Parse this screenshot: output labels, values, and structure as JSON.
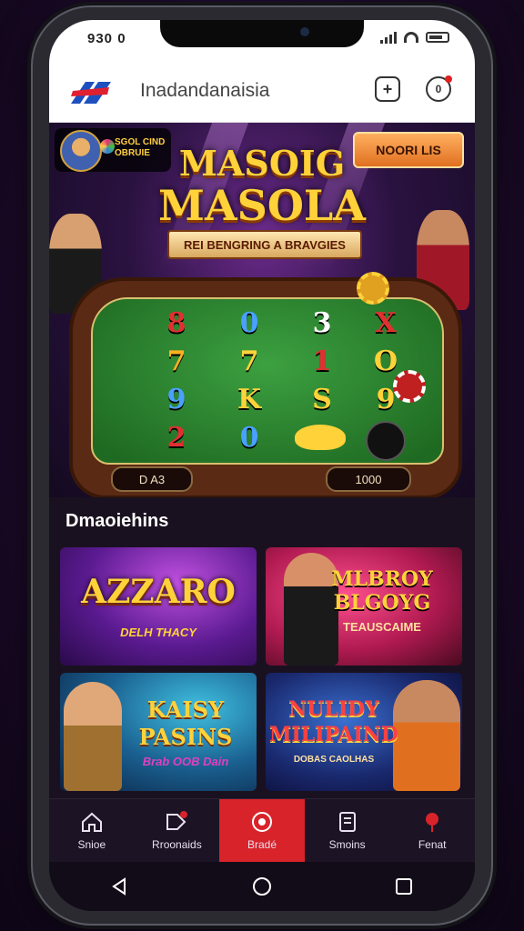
{
  "status": {
    "time": "930 0"
  },
  "appbar": {
    "title": "Inadandanaisia",
    "add_icon": "plus-square-icon",
    "profile_icon": "circle-badge-icon"
  },
  "hero": {
    "badge_logo": "SGOL CIND\nOBRUIE",
    "cta_label": "NOORI LIS",
    "title_line1": "MASOIG",
    "title_line2": "MASOLA",
    "ribbon": "REI BENGRING A BRAVGIES",
    "counter_left": "D A3",
    "counter_right": "1000",
    "symbols": [
      "8",
      "0",
      "3",
      "X",
      "7",
      "7",
      "1",
      "O",
      "9",
      "K",
      "S",
      "9",
      "2",
      "0",
      "",
      ""
    ]
  },
  "section": {
    "title": "Dmaoiehins"
  },
  "cards": [
    {
      "title": "AZZARO",
      "subtitle": "DELH THACY"
    },
    {
      "title": "MLBROY BLGOYG",
      "subtitle": "TEAUSCAIME"
    },
    {
      "title": "KAISY PASINS",
      "subtitle": "Brab OOB Dain"
    },
    {
      "title": "NULIDY MILIPAIND",
      "subtitle": "DOBAS CAOLHAS"
    }
  ],
  "nav": [
    {
      "label": "Snioe",
      "icon": "home-icon",
      "active": false
    },
    {
      "label": "Rroonaids",
      "icon": "tag-badge-icon",
      "active": false
    },
    {
      "label": "Bradé",
      "icon": "target-icon",
      "active": true
    },
    {
      "label": "Smoins",
      "icon": "document-icon",
      "active": false
    },
    {
      "label": "Fenat",
      "icon": "pin-icon",
      "active": false
    }
  ],
  "colors": {
    "accent": "#d8232a",
    "gold": "#ffd23a",
    "felt": "#2f8a34",
    "nav_bg": "#1c1424"
  }
}
